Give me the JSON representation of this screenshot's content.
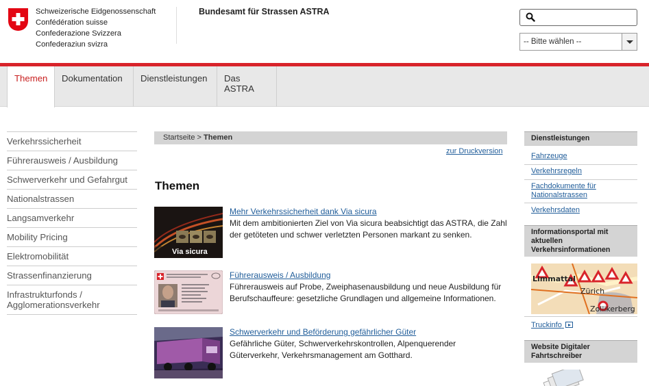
{
  "header": {
    "fed_names": [
      "Schweizerische Eidgenossenschaft",
      "Confédération suisse",
      "Confederazione Svizzera",
      "Confederaziun svizra"
    ],
    "office": "Bundesamt für Strassen ASTRA",
    "search": {
      "placeholder": ""
    },
    "language_select": {
      "selected": "-- Bitte wählen --"
    }
  },
  "nav": {
    "tabs": [
      {
        "label": "Themen",
        "active": true
      },
      {
        "label": "Dokumentation",
        "active": false
      },
      {
        "label": "Dienstleistungen",
        "active": false
      },
      {
        "label": "Das ASTRA",
        "active": false
      }
    ]
  },
  "sidebar": {
    "items": [
      {
        "label": "Verkehrssicherheit"
      },
      {
        "label": "Führerausweis / Ausbildung"
      },
      {
        "label": "Schwerverkehr und Gefahrgut"
      },
      {
        "label": "Nationalstrassen"
      },
      {
        "label": "Langsamverkehr"
      },
      {
        "label": "Mobility Pricing"
      },
      {
        "label": "Elektromobilität"
      },
      {
        "label": "Strassenfinanzierung"
      },
      {
        "label": "Infrastrukturfonds / Agglomerationsverkehr"
      }
    ]
  },
  "main": {
    "breadcrumb": {
      "home": "Startseite",
      "separator": ">",
      "current": "Themen"
    },
    "print_link": "zur Druckversion",
    "title": "Themen",
    "teasers": [
      {
        "title": "Mehr Verkehrssicherheit dank Via sicura",
        "description": "Mit dem ambitionierten Ziel von Via sicura beabsichtigt das ASTRA, die Zahl der getöteten und schwer verletzten Personen markant zu senken.",
        "image_caption": "Via sicura"
      },
      {
        "title": "Führerausweis / Ausbildung",
        "description": "Führerausweis auf Probe, Zweiphasenausbildung und neue Ausbildung für Berufschauffeure: gesetzliche Grundlagen und allgemeine Informationen."
      },
      {
        "title": "Schwerverkehr und Beförderung gefährlicher Güter",
        "description": "Gefährliche Güter, Schwerverkehrskontrollen, Alpenquerender Güterverkehr, Verkehrsmanagement am Gotthard."
      }
    ]
  },
  "right": {
    "services_head": "Dienstleistungen",
    "services": [
      {
        "label": "Fahrzeuge"
      },
      {
        "label": "Verkehrsregeln"
      },
      {
        "label": "Fachdokumente für Nationalstrassen"
      },
      {
        "label": "Verkehrsdaten"
      }
    ],
    "info_head": "Informationsportal mit aktuellen Verkehrsinformationen",
    "map_labels": [
      "Limmattal",
      "Zürich",
      "Zollikerberg"
    ],
    "truckinfo": "Truckinfo",
    "tacho_head": "Website Digitaler Fahrtschreiber"
  },
  "colors": {
    "accent_red": "#d8232a",
    "link_blue": "#1f5c99",
    "nav_bg": "#e8e8e8"
  }
}
